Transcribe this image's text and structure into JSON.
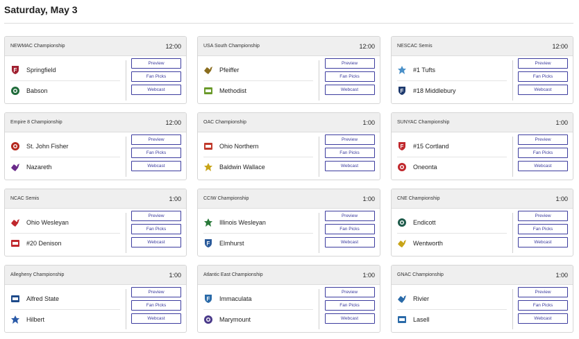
{
  "day_title": "Saturday, May 3",
  "buttons": {
    "preview": "Preview",
    "fan_picks": "Fan Picks",
    "webcast": "Webcast"
  },
  "games": [
    {
      "conference": "NEWMAC Championship",
      "time": "12:00",
      "teams": [
        {
          "name": "Springfield",
          "logo": "springfield-logo",
          "color": "#a02030"
        },
        {
          "name": "Babson",
          "logo": "babson-logo",
          "color": "#1f6b3a"
        }
      ]
    },
    {
      "conference": "USA South Championship",
      "time": "12:00",
      "teams": [
        {
          "name": "Pfeiffer",
          "logo": "pfeiffer-logo",
          "color": "#8a6d1e"
        },
        {
          "name": "Methodist",
          "logo": "methodist-logo",
          "color": "#6a9a2a"
        }
      ]
    },
    {
      "conference": "NESCAC Semis",
      "time": "12:00",
      "teams": [
        {
          "name": "#1 Tufts",
          "logo": "tufts-logo",
          "color": "#4a90c8"
        },
        {
          "name": "#18 Middlebury",
          "logo": "middlebury-logo",
          "color": "#1e3a6e"
        }
      ]
    },
    {
      "conference": "Empire 8 Championship",
      "time": "12:00",
      "teams": [
        {
          "name": "St. John Fisher",
          "logo": "st-john-fisher-logo",
          "color": "#b5281e"
        },
        {
          "name": "Nazareth",
          "logo": "nazareth-logo",
          "color": "#6a2a8a"
        }
      ]
    },
    {
      "conference": "OAC Championship",
      "time": "1:00",
      "teams": [
        {
          "name": "Ohio Northern",
          "logo": "ohio-northern-logo",
          "color": "#c0392b"
        },
        {
          "name": "Baldwin Wallace",
          "logo": "baldwin-wallace-logo",
          "color": "#c8a418"
        }
      ]
    },
    {
      "conference": "SUNYAC Championship",
      "time": "1:00",
      "teams": [
        {
          "name": "#15 Cortland",
          "logo": "cortland-logo",
          "color": "#c0282d"
        },
        {
          "name": "Oneonta",
          "logo": "oneonta-logo",
          "color": "#c0282d"
        }
      ]
    },
    {
      "conference": "NCAC Semis",
      "time": "1:00",
      "teams": [
        {
          "name": "Ohio Wesleyan",
          "logo": "ohio-wesleyan-logo",
          "color": "#c0282d"
        },
        {
          "name": "#20 Denison",
          "logo": "denison-logo",
          "color": "#c0282d"
        }
      ]
    },
    {
      "conference": "CCIW Championship",
      "time": "1:00",
      "teams": [
        {
          "name": "Illinois Wesleyan",
          "logo": "illinois-wesleyan-logo",
          "color": "#2a7a3a"
        },
        {
          "name": "Elmhurst",
          "logo": "elmhurst-logo",
          "color": "#2a5a9a"
        }
      ]
    },
    {
      "conference": "CNE Championship",
      "time": "1:00",
      "teams": [
        {
          "name": "Endicott",
          "logo": "endicott-logo",
          "color": "#1e5a4a"
        },
        {
          "name": "Wentworth",
          "logo": "wentworth-logo",
          "color": "#c8a418"
        }
      ]
    },
    {
      "conference": "Allegheny Championship",
      "time": "1:00",
      "teams": [
        {
          "name": "Alfred State",
          "logo": "alfred-state-logo",
          "color": "#1e4a8a"
        },
        {
          "name": "Hilbert",
          "logo": "hilbert-logo",
          "color": "#2a5aa8"
        }
      ]
    },
    {
      "conference": "Atlantic East Championship",
      "time": "1:00",
      "teams": [
        {
          "name": "Immaculata",
          "logo": "immaculata-logo",
          "color": "#2a6aa8"
        },
        {
          "name": "Marymount",
          "logo": "marymount-logo",
          "color": "#4a3a8a"
        }
      ]
    },
    {
      "conference": "GNAC Championship",
      "time": "1:00",
      "teams": [
        {
          "name": "Rivier",
          "logo": "rivier-logo",
          "color": "#2a6aa8"
        },
        {
          "name": "Lasell",
          "logo": "lasell-logo",
          "color": "#2a6aa8"
        }
      ]
    }
  ]
}
